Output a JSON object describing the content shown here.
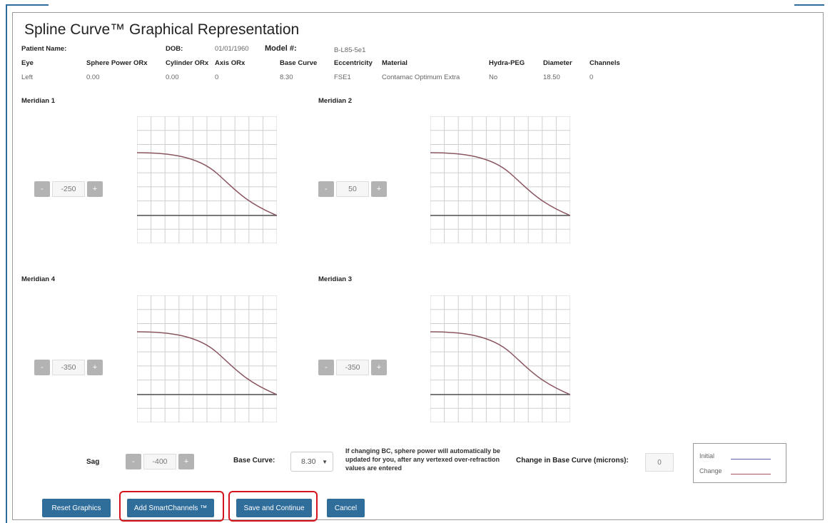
{
  "title": "Spline Curve™ Graphical Representation",
  "header": {
    "patient_name_label": "Patient Name:",
    "patient_name_value": "",
    "dob_label": "DOB:",
    "dob_value": "01/01/1960",
    "model_label": "Model #:",
    "model_value": "B-L85-5e1"
  },
  "params": {
    "headers": [
      "Eye",
      "Sphere Power ORx",
      "Cylinder ORx",
      "Axis ORx",
      "Base Curve",
      "Eccentricity",
      "Material",
      "Hydra-PEG",
      "Diameter",
      "Channels"
    ],
    "values": [
      "Left",
      "0.00",
      "0.00",
      "0",
      "8.30",
      "FSE1",
      "Contamac Optimum Extra",
      "No",
      "18.50",
      "0"
    ]
  },
  "meridians": [
    {
      "title": "Meridian 1",
      "value": "-250",
      "minus": "-",
      "plus": "+"
    },
    {
      "title": "Meridian 2",
      "value": "50",
      "minus": "-",
      "plus": "+"
    },
    {
      "title": "Meridian 4",
      "value": "-350",
      "minus": "-",
      "plus": "+"
    },
    {
      "title": "Meridian 3",
      "value": "-350",
      "minus": "-",
      "plus": "+"
    }
  ],
  "sag": {
    "label": "Sag",
    "value": "-400",
    "minus": "-",
    "plus": "+"
  },
  "base_curve": {
    "label": "Base Curve:",
    "value": "8.30",
    "note": "If changing BC, sphere power will automatically be updated for you, after any vertexed over-refraction values are entered"
  },
  "change_bc": {
    "label": "Change in Base Curve (microns):",
    "value": "0"
  },
  "legend": {
    "initial_label": "Initial",
    "change_label": "Change",
    "initial_color": "#5b5ea6",
    "change_color": "#a0525e"
  },
  "buttons": {
    "reset": "Reset Graphics",
    "smartchannels": "Add SmartChannels ™",
    "save": "Save and Continue",
    "cancel": "Cancel"
  },
  "colors": {
    "primary_button": "#2f6d9b",
    "highlight": "#d4141b",
    "curve": "#8a5660"
  }
}
